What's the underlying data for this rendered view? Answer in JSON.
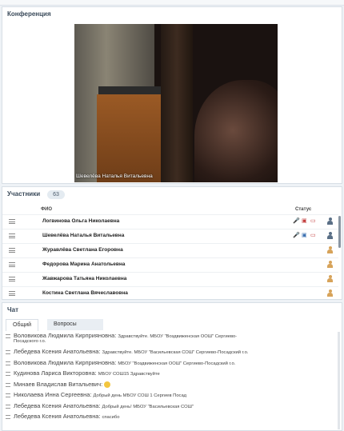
{
  "conference": {
    "title": "Конференция",
    "video_caption": "Шевелёва Наталья Витальевна"
  },
  "participants": {
    "title": "Участники",
    "count": "63",
    "col_fio": "ФИО",
    "col_status": "Статус",
    "rows": [
      {
        "name": "Логвинова Ольга  Николаевна"
      },
      {
        "name": "Шевелёва Наталья Витальевна"
      },
      {
        "name": "Журавлёва Светлана  Егоровна"
      },
      {
        "name": "Федорова Марина Анатольевна"
      },
      {
        "name": "Жавжарова Татьяна Николаевна"
      },
      {
        "name": "Костина Светлана Вячеславовна"
      }
    ]
  },
  "chat": {
    "title": "Чат",
    "tabs": [
      "Общий",
      "Вопросы"
    ],
    "messages": [
      {
        "author": "Воловикова Людмила Кирприяновна:",
        "text": "Здравствуйте. МБОУ \"Воздвиженская ООШ\" Сергиево-",
        "text2": "Посадского г.о."
      },
      {
        "author": "Лебедева Ксения Анатольевна:",
        "text": "Здравствуйте. МБОУ \"Васильевская СОШ\" Сергиево-Посадский г.о."
      },
      {
        "author": "Воловикова Людмила Кирприяновна:",
        "text": "МБОУ \"Воздвиженская ООШ\" Сергиево-Посадский г.о."
      },
      {
        "author": "Кудинова Лариса Викторовна:",
        "text": "МБОУ СОШ15 Здравствуйте"
      },
      {
        "author": "Минаев Владислав Витальевич:",
        "text": ""
      },
      {
        "author": "Николаева Инна Сергеевна:",
        "text": "Добрый день МБОУ СОШ 1 Сергиев Посад"
      },
      {
        "author": "Лебедева Ксения Анатольевна:",
        "text": "Добрый день! МБОУ \"Васильевская СОШ\""
      },
      {
        "author": "Лебедева Ксения Анатольевна:",
        "text": "спасибо"
      }
    ]
  }
}
